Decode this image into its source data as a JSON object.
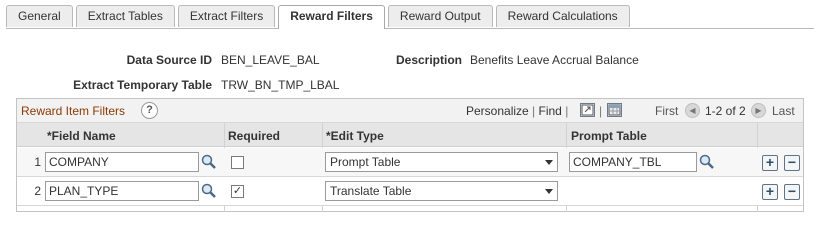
{
  "tabs": [
    {
      "label": "General",
      "active": false
    },
    {
      "label": "Extract Tables",
      "active": false
    },
    {
      "label": "Extract Filters",
      "active": false
    },
    {
      "label": "Reward Filters",
      "active": true
    },
    {
      "label": "Reward Output",
      "active": false
    },
    {
      "label": "Reward Calculations",
      "active": false
    }
  ],
  "header": {
    "data_source_id_label": "Data Source ID",
    "data_source_id_value": "BEN_LEAVE_BAL",
    "description_label": "Description",
    "description_value": "Benefits Leave Accrual Balance",
    "extract_temp_table_label": "Extract Temporary Table",
    "extract_temp_table_value": "TRW_BN_TMP_LBAL"
  },
  "grid": {
    "title": "Reward Item Filters",
    "help_icon": "question-icon",
    "personalize": "Personalize",
    "find": "Find",
    "first": "First",
    "range": "1-2 of 2",
    "last": "Last",
    "columns": {
      "field_name": "*Field Name",
      "required": "Required",
      "edit_type": "*Edit Type",
      "prompt_table": "Prompt Table"
    },
    "rows": [
      {
        "num": "1",
        "field_name": "COMPANY",
        "required": false,
        "edit_type": "Prompt Table",
        "prompt_table": "COMPANY_TBL"
      },
      {
        "num": "2",
        "field_name": "PLAN_TYPE",
        "required": true,
        "edit_type": "Translate Table",
        "prompt_table": ""
      }
    ]
  }
}
